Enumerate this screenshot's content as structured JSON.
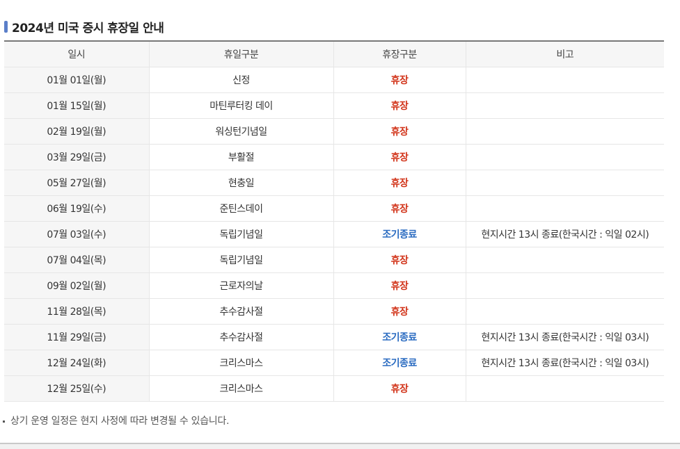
{
  "title": "2024년 미국 증시 휴장일 안내",
  "table": {
    "headers": [
      "일시",
      "휴일구분",
      "휴장구분",
      "비고"
    ],
    "rows": [
      {
        "date": "01월 01일(월)",
        "holiday": "신정",
        "status": "휴장",
        "status_type": "closed",
        "note": ""
      },
      {
        "date": "01월 15일(월)",
        "holiday": "마틴루터킹 데이",
        "status": "휴장",
        "status_type": "closed",
        "note": ""
      },
      {
        "date": "02월 19일(월)",
        "holiday": "워싱턴기념일",
        "status": "휴장",
        "status_type": "closed",
        "note": ""
      },
      {
        "date": "03월 29일(금)",
        "holiday": "부활절",
        "status": "휴장",
        "status_type": "closed",
        "note": ""
      },
      {
        "date": "05월 27일(월)",
        "holiday": "현충일",
        "status": "휴장",
        "status_type": "closed",
        "note": ""
      },
      {
        "date": "06월 19일(수)",
        "holiday": "준틴스데이",
        "status": "휴장",
        "status_type": "closed",
        "note": ""
      },
      {
        "date": "07월 03일(수)",
        "holiday": "독립기념일",
        "status": "조기종료",
        "status_type": "early",
        "note": "현지시간 13시 종료(한국시간 : 익일 02시)"
      },
      {
        "date": "07월 04일(목)",
        "holiday": "독립기념일",
        "status": "휴장",
        "status_type": "closed",
        "note": ""
      },
      {
        "date": "09월 02일(월)",
        "holiday": "근로자의날",
        "status": "휴장",
        "status_type": "closed",
        "note": ""
      },
      {
        "date": "11월 28일(목)",
        "holiday": "추수감사절",
        "status": "휴장",
        "status_type": "closed",
        "note": ""
      },
      {
        "date": "11월 29일(금)",
        "holiday": "추수감사절",
        "status": "조기종료",
        "status_type": "early",
        "note": "현지시간 13시 종료(한국시간 : 익일 03시)"
      },
      {
        "date": "12월 24일(화)",
        "holiday": "크리스마스",
        "status": "조기종료",
        "status_type": "early",
        "note": "현지시간 13시 종료(한국시간 : 익일 03시)"
      },
      {
        "date": "12월 25일(수)",
        "holiday": "크리스마스",
        "status": "휴장",
        "status_type": "closed",
        "note": ""
      }
    ]
  },
  "footnote": "상기 운영 일정은 현지 사정에 따라 변경될 수 있습니다.",
  "colors": {
    "closed": "#d2351b",
    "early": "#2b6cc1",
    "accent": "#5b7fc9"
  }
}
